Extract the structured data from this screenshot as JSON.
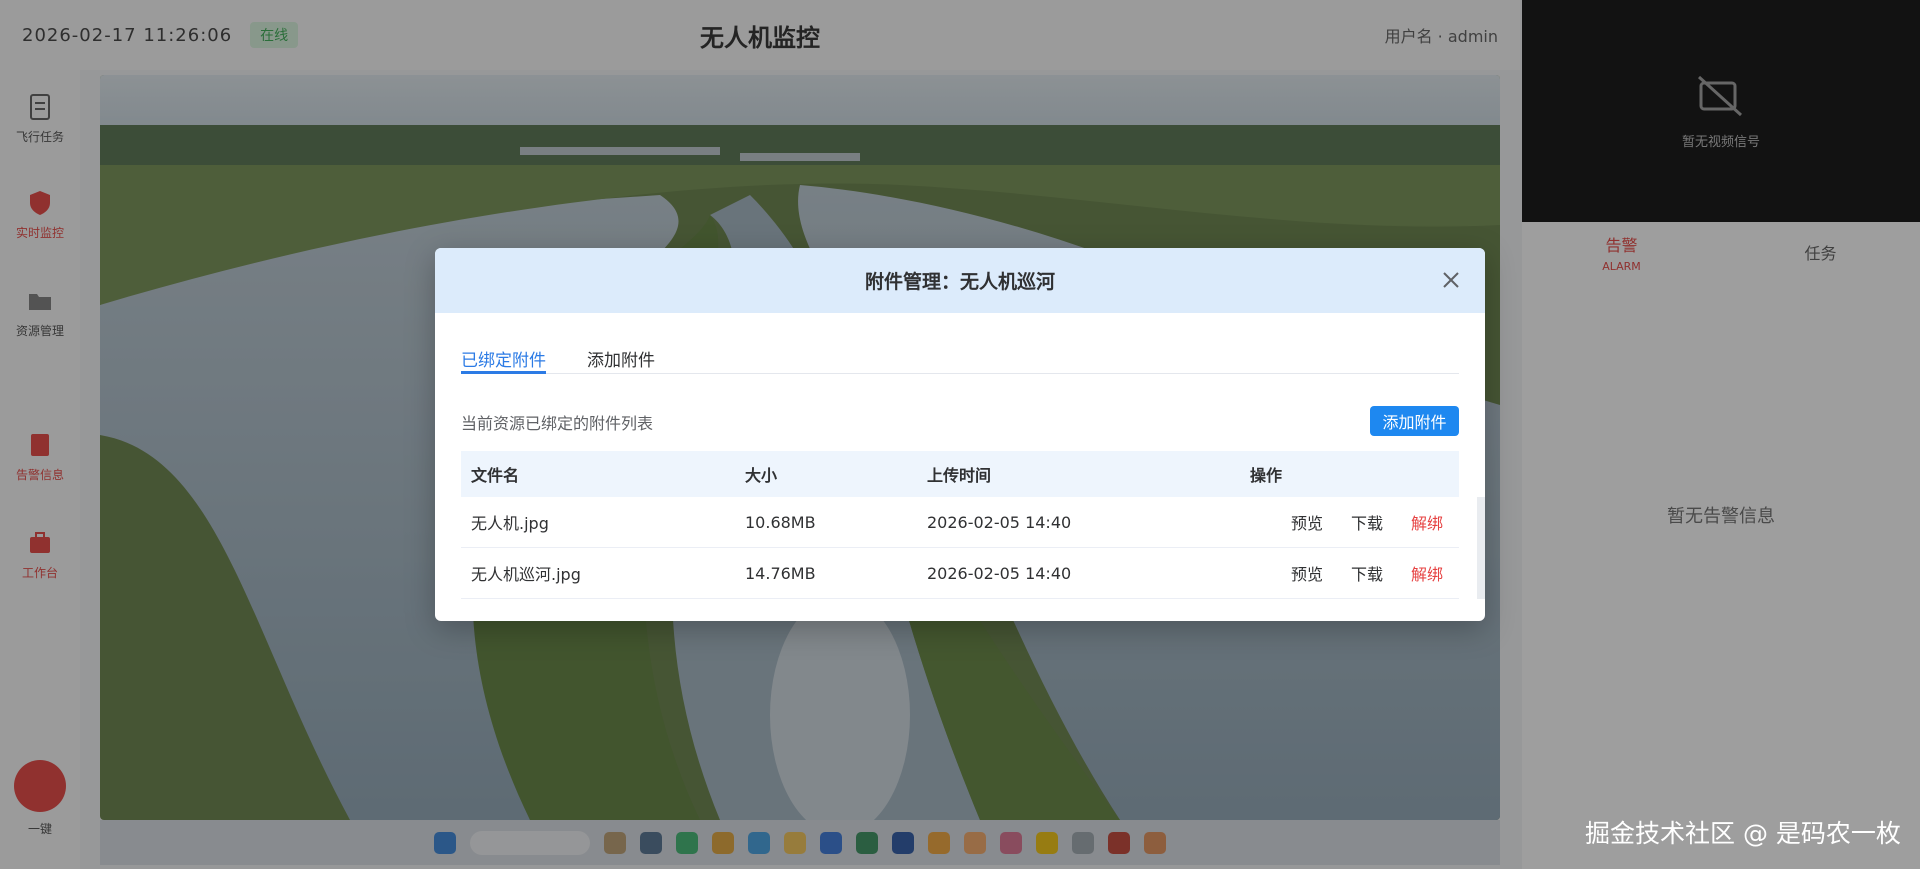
{
  "topbar": {
    "datetime": "2026-02-17 11:26:06",
    "status": "在线",
    "title": "无人机监控",
    "user": "用户名 · admin"
  },
  "leftnav": [
    {
      "label": "飞行任务",
      "icon": "document-icon"
    },
    {
      "label": "实时监控",
      "icon": "shield-icon"
    },
    {
      "label": "资源管理",
      "icon": "folder-icon"
    },
    {
      "label": "告警信息",
      "icon": "alert-icon"
    },
    {
      "label": "工作台",
      "icon": "briefcase-icon"
    }
  ],
  "fab_label": "一键",
  "right_video": {
    "message": "暂无视频信号"
  },
  "right_panel": {
    "tabs": [
      {
        "label": "告警",
        "sub": "ALARM"
      },
      {
        "label": "任务",
        "sub": ""
      }
    ],
    "empty_text": "暂无告警信息"
  },
  "modal": {
    "title": "附件管理：无人机巡河",
    "tabs": [
      "已绑定附件",
      "添加附件"
    ],
    "description": "当前资源已绑定的附件列表",
    "add_button": "添加附件",
    "columns": [
      "文件名",
      "大小",
      "上传时间",
      "操作"
    ],
    "rows": [
      {
        "name": "无人机.jpg",
        "size": "10.68MB",
        "time": "2026-02-05 14:40"
      },
      {
        "name": "无人机巡河.jpg",
        "size": "14.76MB",
        "time": "2026-02-05 14:40"
      }
    ],
    "actions": {
      "preview": "预览",
      "download": "下载",
      "unbind": "解绑"
    }
  },
  "watermark": "掘金技术社区 @ 是码农一枚",
  "colors": {
    "primary": "#1e88f0",
    "danger": "#e64242",
    "header_bg": "#dcebfb"
  }
}
